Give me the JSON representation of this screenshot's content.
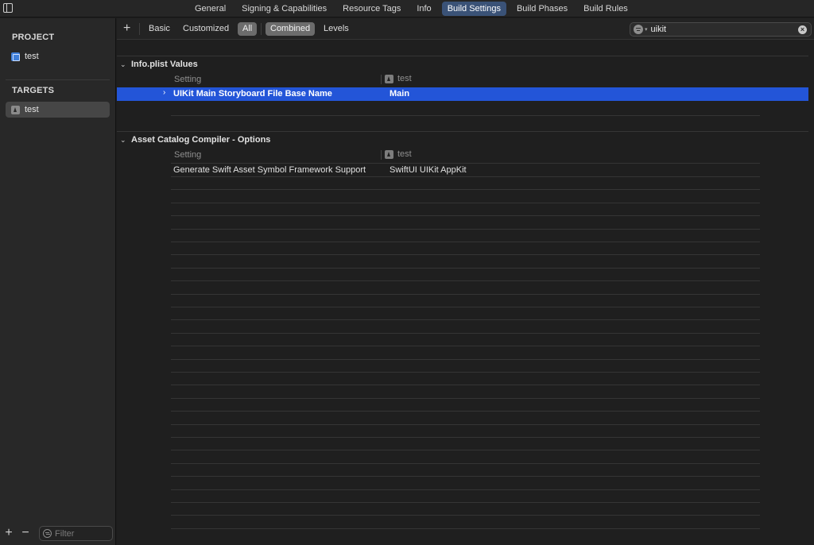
{
  "tabs": [
    "General",
    "Signing & Capabilities",
    "Resource Tags",
    "Info",
    "Build Settings",
    "Build Phases",
    "Build Rules"
  ],
  "active_tab": "Build Settings",
  "sidebar": {
    "project_header": "PROJECT",
    "project_item": "test",
    "targets_header": "TARGETS",
    "target_item": "test",
    "filter_placeholder": "Filter"
  },
  "toolbar": {
    "basic": "Basic",
    "customized": "Customized",
    "all": "All",
    "combined": "Combined",
    "levels": "Levels",
    "search_value": "uikit"
  },
  "groups": [
    {
      "title": "Info.plist Values",
      "col_setting": "Setting",
      "col_target": "test",
      "rows": [
        {
          "name": "UIKit Main Storyboard File Base Name",
          "value": "Main",
          "selected": true
        }
      ]
    },
    {
      "title": "Asset Catalog Compiler - Options",
      "col_setting": "Setting",
      "col_target": "test",
      "rows": [
        {
          "name": "Generate Swift Asset Symbol Framework Support",
          "value": "SwiftUI UIKit AppKit",
          "selected": false
        }
      ]
    }
  ],
  "icons": {
    "sidebar_toggle": "sidebar-toggle-icon",
    "project": "project-icon",
    "target": "app-target-icon",
    "filter": "filter-icon",
    "clear": "clear-icon",
    "chevron_down": "chevron-down-icon",
    "chevron_right": "chevron-right-icon"
  },
  "colors": {
    "accent_tab": "#3a5277",
    "selection": "#2355d8"
  }
}
